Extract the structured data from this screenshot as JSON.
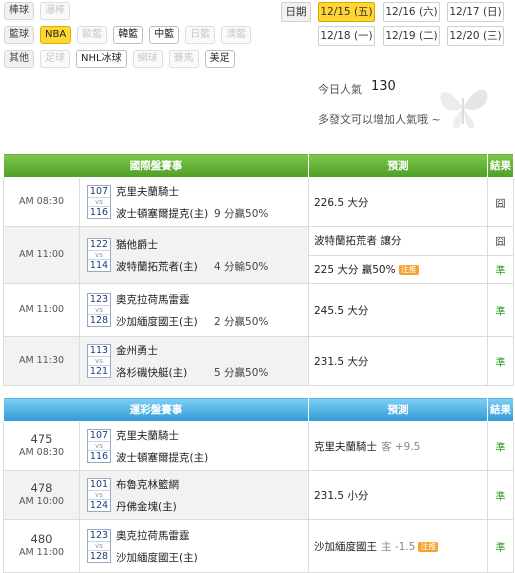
{
  "filters": {
    "rows": [
      {
        "label": "棒球",
        "items": [
          {
            "text": "瀑棒",
            "state": "off"
          }
        ]
      },
      {
        "label": "籃球",
        "items": [
          {
            "text": "NBA",
            "state": "sel"
          },
          {
            "text": "歐籃",
            "state": "off"
          },
          {
            "text": "韓籃",
            "state": "on"
          },
          {
            "text": "中籃",
            "state": "on"
          },
          {
            "text": "日籃",
            "state": "off"
          },
          {
            "text": "澳籃",
            "state": "off"
          }
        ]
      },
      {
        "label": "其他",
        "items": [
          {
            "text": "足球",
            "state": "off"
          },
          {
            "text": "NHL冰球",
            "state": "on"
          },
          {
            "text": "網球",
            "state": "off"
          },
          {
            "text": "賽馬",
            "state": "off"
          },
          {
            "text": "美足",
            "state": "on"
          }
        ]
      }
    ]
  },
  "dates": {
    "label": "日期",
    "items": [
      "12/15 (五)",
      "12/16 (六)",
      "12/17 (日)",
      "12/18 (一)",
      "12/19 (二)",
      "12/20 (三)"
    ],
    "selected_index": 0
  },
  "popularity": {
    "label": "今日人氣",
    "value": "130",
    "tip": "多發文可以增加人氣哦 ~"
  },
  "intl_table": {
    "headers": [
      "國際盤賽事",
      "預測",
      "結果"
    ],
    "rows": [
      {
        "time": "AM 08:30",
        "score_top": "107",
        "score_bottom": "116",
        "team_top": "克里夫蘭騎士",
        "team_bottom": "波士頓塞爾提克(主)",
        "note": "9 分贏50%",
        "preds": [
          {
            "text": "226.5 大分",
            "hint": "",
            "result": "囧"
          }
        ]
      },
      {
        "time": "AM 11:00",
        "score_top": "122",
        "score_bottom": "114",
        "team_top": "猶他爵士",
        "team_bottom": "波特蘭拓荒者(主)",
        "note": "4 分輸50%",
        "preds": [
          {
            "text": "波特蘭拓荒者 讓分",
            "hint": "",
            "result": "囧"
          },
          {
            "text": "225 大分 贏50%",
            "hint": "注推",
            "result": "準"
          }
        ]
      },
      {
        "time": "AM 11:00",
        "score_top": "123",
        "score_bottom": "128",
        "team_top": "奧克拉荷馬雷霆",
        "team_bottom": "沙加緬度國王(主)",
        "note": "2 分贏50%",
        "preds": [
          {
            "text": "245.5 大分",
            "hint": "",
            "result": "準"
          }
        ]
      },
      {
        "time": "AM 11:30",
        "score_top": "113",
        "score_bottom": "121",
        "team_top": "金州勇士",
        "team_bottom": "洛杉磯快艇(主)",
        "note": "5 分贏50%",
        "preds": [
          {
            "text": "231.5 大分",
            "hint": "",
            "result": "準"
          }
        ]
      }
    ]
  },
  "lottery_table": {
    "headers": [
      "運彩盤賽事",
      "預測",
      "結果"
    ],
    "rows": [
      {
        "no": "475",
        "time": "AM 08:30",
        "score_top": "107",
        "score_bottom": "116",
        "team_top": "克里夫蘭騎士",
        "team_bottom": "波士頓塞爾提克(主)",
        "pred": "克里夫蘭騎士",
        "pred_extra": "客 +9.5",
        "hint": "",
        "result": "準"
      },
      {
        "no": "478",
        "time": "AM 10:00",
        "score_top": "101",
        "score_bottom": "124",
        "team_top": "布魯克林籃網",
        "team_bottom": "丹佛金塊(主)",
        "pred": "231.5 小分",
        "pred_extra": "",
        "hint": "",
        "result": "準"
      },
      {
        "no": "480",
        "time": "AM 11:00",
        "score_top": "123",
        "score_bottom": "128",
        "team_top": "奧克拉荷馬雷霆",
        "team_bottom": "沙加緬度國王(主)",
        "pred": "沙加緬度國王",
        "pred_extra": "主 -1.5",
        "hint": "注推",
        "result": "準"
      }
    ]
  },
  "vs_label": "vs",
  "colors": {
    "selected": "#ffd633",
    "green_header": "#5aa82d",
    "blue_header": "#3ca3dc",
    "win": "#2a9d1c",
    "hint": "#f7a12f"
  }
}
